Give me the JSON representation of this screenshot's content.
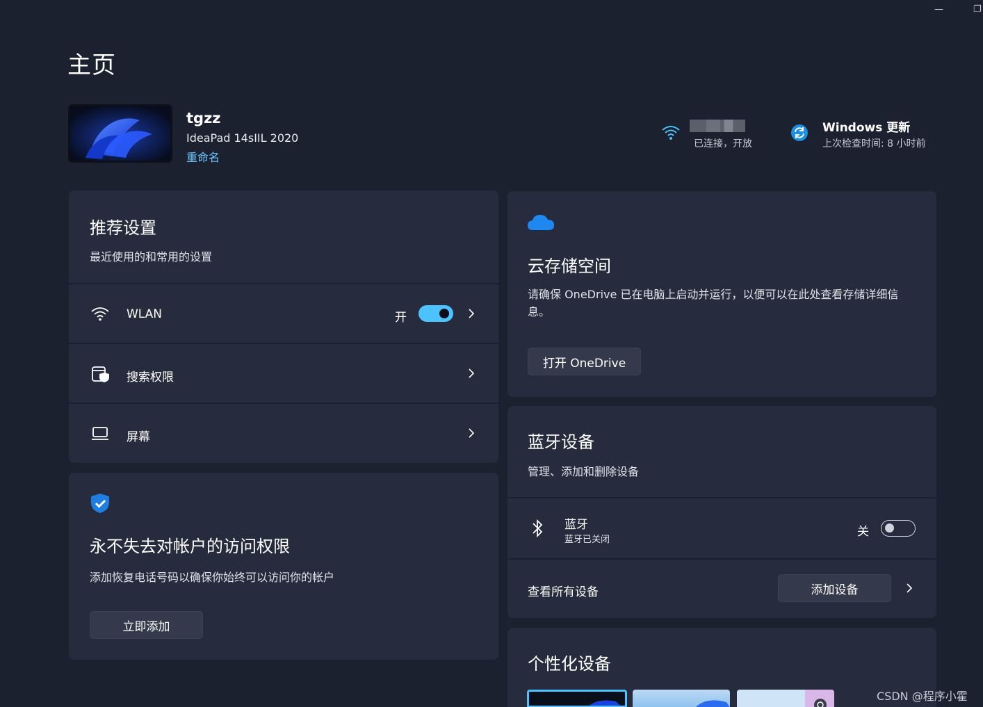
{
  "window": {
    "minimize_glyph": "—",
    "restore_glyph": "❐"
  },
  "page": {
    "title": "主页"
  },
  "device": {
    "name": "tgzz",
    "model": "IdeaPad 14sIIL 2020",
    "rename_label": "重命名"
  },
  "status": {
    "wifi_state": "已连接，开放",
    "update_title": "Windows 更新",
    "update_sub": "上次检查时间: 8 小时前"
  },
  "recommended": {
    "title": "推荐设置",
    "subtitle": "最近使用的和常用的设置",
    "rows": [
      {
        "label": "WLAN",
        "state": "开",
        "icon": "wifi-icon"
      },
      {
        "label": "搜索权限",
        "icon": "search-permission-icon"
      },
      {
        "label": "屏幕",
        "icon": "laptop-icon"
      }
    ]
  },
  "account": {
    "title": "永不失去对帐户的访问权限",
    "subtitle": "添加恢复电话号码以确保你始终可以访问你的帐户",
    "button": "立即添加"
  },
  "cloud": {
    "title": "云存储空间",
    "subtitle": "请确保 OneDrive 已在电脑上启动并运行，以便可以在此处查看存储详细信息。",
    "button": "打开 OneDrive"
  },
  "bluetooth": {
    "title": "蓝牙设备",
    "subtitle": "管理、添加和删除设备",
    "bt_label": "蓝牙",
    "bt_sub": "蓝牙已关闭",
    "bt_state": "关",
    "view_all": "查看所有设备",
    "add_button": "添加设备"
  },
  "personalize": {
    "title": "个性化设备"
  },
  "watermark": "CSDN @程序小霍",
  "colors": {
    "accent": "#4cc2ff",
    "background": "#1c2130",
    "card": "#262c3d",
    "link": "#6cc4ff"
  }
}
